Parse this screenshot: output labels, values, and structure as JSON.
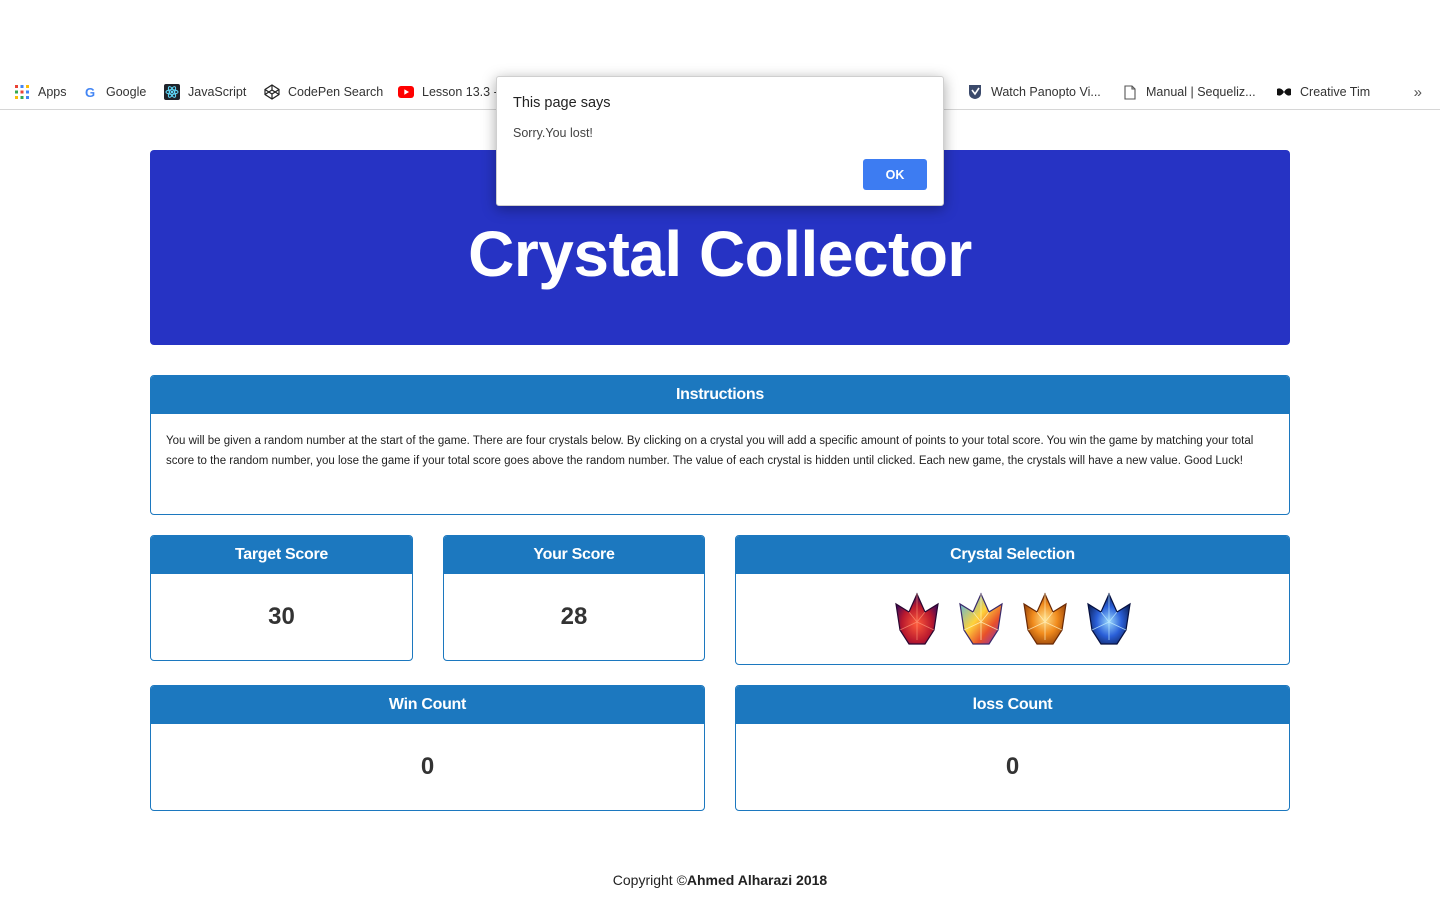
{
  "bookmarks": [
    {
      "label": "Apps",
      "icon": "apps-grid-icon"
    },
    {
      "label": "Google",
      "icon": "google-icon"
    },
    {
      "label": "JavaScript",
      "icon": "react-icon"
    },
    {
      "label": "CodePen Search",
      "icon": "codepen-icon"
    },
    {
      "label": "Lesson 13.3 -",
      "icon": "youtube-icon"
    },
    {
      "label": "Watch Panopto Vi...",
      "icon": "panopto-icon"
    },
    {
      "label": "Manual | Sequeliz...",
      "icon": "document-icon"
    },
    {
      "label": "Creative Tim",
      "icon": "creative-tim-icon"
    }
  ],
  "bookmarks_overflow": "»",
  "header": {
    "title": "Crystal Collector"
  },
  "instructions": {
    "title": "Instructions",
    "text": "You will be given a random number at the start of the game. There are four crystals below. By clicking on a crystal you will add a specific amount of points to your total score. You win the game by matching your total score to the random number, you lose the game if your total score goes above the random number. The value of each crystal is hidden until clicked. Each new game, the crystals will have a new value. Good Luck!"
  },
  "target": {
    "title": "Target Score",
    "value": "30"
  },
  "score": {
    "title": "Your Score",
    "value": "28"
  },
  "crystal_selection": {
    "title": "Crystal Selection",
    "crystals": [
      {
        "name": "red-crystal",
        "color": "#b8182e"
      },
      {
        "name": "rainbow-crystal",
        "color": "#e8702a"
      },
      {
        "name": "orange-crystal",
        "color": "#f08a1c"
      },
      {
        "name": "blue-crystal",
        "color": "#2a5fd8"
      }
    ]
  },
  "wins": {
    "title": "Win Count",
    "value": "0"
  },
  "losses": {
    "title": "loss Count",
    "value": "0"
  },
  "footer": {
    "prefix": "Copyright ©",
    "author": "Ahmed Alharazi 2018"
  },
  "dialog": {
    "title": "This page says",
    "message": "Sorry.You lost!",
    "ok_label": "OK"
  },
  "colors": {
    "jumbotron": "#2633c4",
    "panel": "#1c78bf",
    "ok_button": "#3d7cf2"
  }
}
